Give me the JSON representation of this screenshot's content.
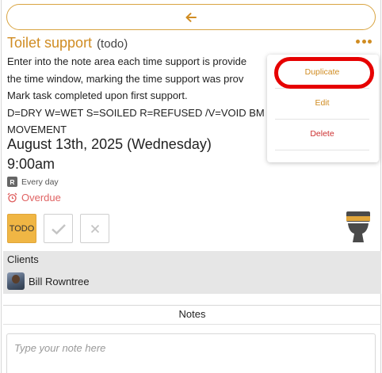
{
  "task": {
    "title": "Toilet support",
    "status_suffix": "(todo)",
    "description_lines": [
      "Enter into the note area each time support is provide",
      "the time window, marking the time support was prov",
      "Mark task completed upon first support.",
      "D=DRY W=WET S=SOILED R=REFUSED /V=VOID BM",
      "MOVEMENT"
    ],
    "date": "August 13th, 2025 (Wednesday)",
    "time": "9:00am",
    "repeat_badge": "R",
    "repeat": "Every day",
    "overdue": "Overdue"
  },
  "status_buttons": {
    "todo": "TODO"
  },
  "menu": {
    "duplicate": "Duplicate",
    "edit": "Edit",
    "delete": "Delete"
  },
  "clients": {
    "header": "Clients",
    "items": [
      {
        "name": "Bill Rowntree"
      }
    ]
  },
  "notes": {
    "title": "Notes",
    "placeholder": "Type your note here"
  },
  "colors": {
    "accent": "#d08c22",
    "todo_fill": "#f0b644",
    "overdue": "#e06363",
    "delete": "#cc2f2f",
    "highlight": "#e60000"
  },
  "icons": {
    "back": "arrow-left-icon",
    "more": "more-dots-icon",
    "overdue": "alarm-clock-icon",
    "done": "checkmark-icon",
    "cancel": "x-icon",
    "toilet": "toilet-icon"
  }
}
